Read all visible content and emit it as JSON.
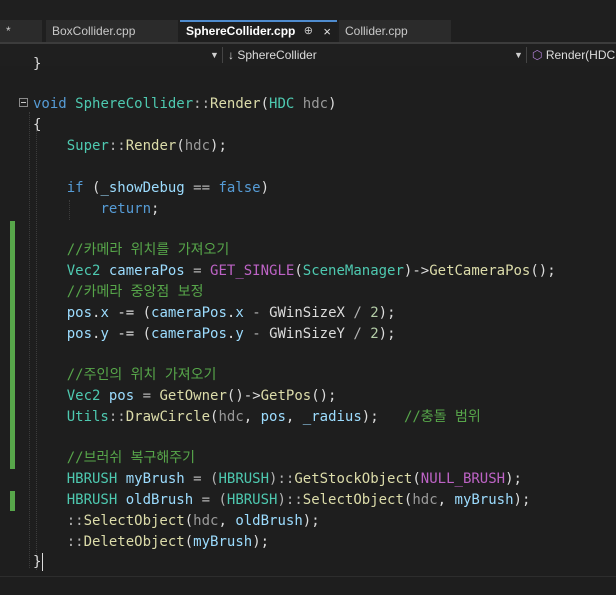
{
  "tabs": [
    {
      "label": "*"
    },
    {
      "label": "BoxCollider.cpp"
    },
    {
      "label": "SphereCollider.cpp",
      "pin": "⊕",
      "close": "×"
    },
    {
      "label": "Collider.cpp"
    }
  ],
  "navigation": {
    "scope_label": "SphereCollider",
    "scope_icon": "↓",
    "member_label": "Render(HDC",
    "member_icon": "⬡"
  },
  "code": {
    "top_fragment": "}",
    "l1_a": "void",
    "l1_b": "SphereCollider",
    "l1_c": "::",
    "l1_d": "Render",
    "l1_e": "(",
    "l1_f": "HDC",
    "l1_g": " ",
    "l1_h": "hdc",
    "l1_i": ")",
    "l2": "{",
    "l3_a": "Super",
    "l3_b": "::",
    "l3_c": "Render",
    "l3_d": "(",
    "l3_e": "hdc",
    "l3_f": ");",
    "l4_a": "if",
    "l4_b": " (",
    "l4_c": "_showDebug",
    "l4_d": " == ",
    "l4_e": "false",
    "l4_f": ")",
    "l5_a": "return",
    "l5_b": ";",
    "l6": "//카메라 위치를 가져오기",
    "l7_a": "Vec2",
    "l7_b": " ",
    "l7_c": "cameraPos",
    "l7_d": " = ",
    "l7_e": "GET_SINGLE",
    "l7_f": "(",
    "l7_g": "SceneManager",
    "l7_h": ")->",
    "l7_i": "GetCameraPos",
    "l7_j": "();",
    "l8": "//카메라 중앙점 보정",
    "l9_a": "pos",
    "l9_b": ".",
    "l9_c": "x",
    "l9_d": " -= (",
    "l9_e": "cameraPos",
    "l9_f": ".",
    "l9_g": "x",
    "l9_h": " - ",
    "l9_i": "GWinSizeX",
    "l9_j": " / ",
    "l9_k": "2",
    "l9_l": ");",
    "l10_a": "pos",
    "l10_b": ".",
    "l10_c": "y",
    "l10_d": " -= (",
    "l10_e": "cameraPos",
    "l10_f": ".",
    "l10_g": "y",
    "l10_h": " - ",
    "l10_i": "GWinSizeY",
    "l10_j": " / ",
    "l10_k": "2",
    "l10_l": ");",
    "l11": "//주인의 위치 가져오기",
    "l12_a": "Vec2",
    "l12_b": " ",
    "l12_c": "pos",
    "l12_d": " = ",
    "l12_e": "GetOwner",
    "l12_f": "()->",
    "l12_g": "GetPos",
    "l12_h": "();",
    "l13_a": "Utils",
    "l13_b": "::",
    "l13_c": "DrawCircle",
    "l13_d": "(",
    "l13_e": "hdc",
    "l13_f": ", ",
    "l13_g": "pos",
    "l13_h": ", ",
    "l13_i": "_radius",
    "l13_j": ");   ",
    "l13_k": "//충돌 범위",
    "l14": "//브러쉬 복구해주기",
    "l15_a": "HBRUSH",
    "l15_b": " ",
    "l15_c": "myBrush",
    "l15_d": " = (",
    "l15_e": "HBRUSH",
    "l15_f": ")::",
    "l15_g": "GetStockObject",
    "l15_h": "(",
    "l15_i": "NULL_BRUSH",
    "l15_j": ");",
    "l16_a": "HBRUSH",
    "l16_b": " ",
    "l16_c": "oldBrush",
    "l16_d": " = (",
    "l16_e": "HBRUSH",
    "l16_f": ")::",
    "l16_g": "SelectObject",
    "l16_h": "(",
    "l16_i": "hdc",
    "l16_j": ", ",
    "l16_k": "myBrush",
    "l16_l": ");",
    "l17_a": "::",
    "l17_b": "SelectObject",
    "l17_c": "(",
    "l17_d": "hdc",
    "l17_e": ", ",
    "l17_f": "oldBrush",
    "l17_g": ");",
    "l18_a": "::",
    "l18_b": "DeleteObject",
    "l18_c": "(",
    "l18_d": "myBrush",
    "l18_e": ");",
    "l19": "}"
  },
  "colors": {
    "keyword": "#569cd6",
    "type": "#4ec9b0",
    "function": "#dcdcaa",
    "variable": "#9cdcfe",
    "comment": "#57a64a",
    "macro": "#bd63c5",
    "change_bar": "#57a64a",
    "active_tab_accent": "#4f8ccf"
  }
}
